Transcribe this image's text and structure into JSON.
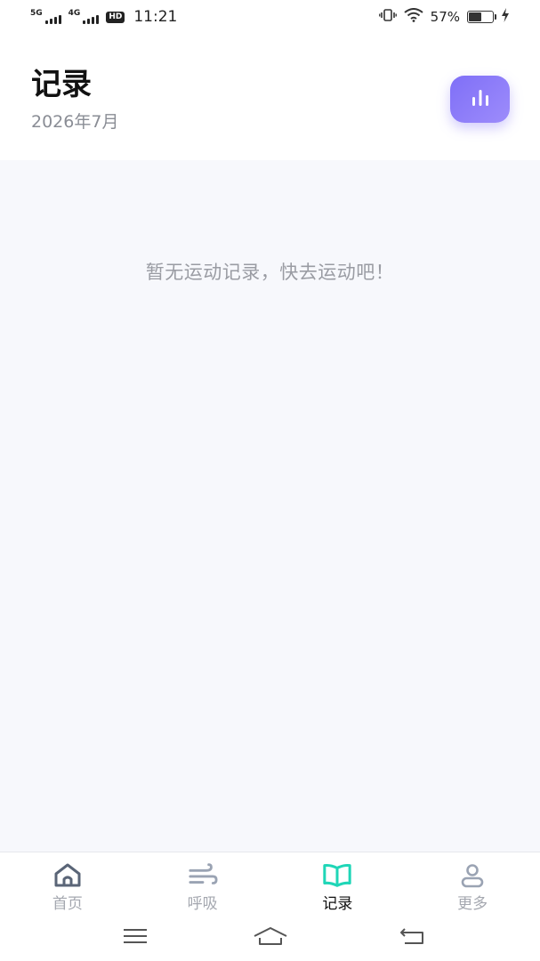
{
  "status_bar": {
    "sig1_label": "5G",
    "sig2_label": "4G",
    "hd_label": "HD",
    "time": "11:21",
    "battery_percent": "57%",
    "battery_level": 0.57
  },
  "header": {
    "title": "记录",
    "subtitle": "2026年7月",
    "stats_icon": "bar-chart-icon"
  },
  "content": {
    "empty_message": "暂无运动记录，快去运动吧！"
  },
  "bottom_nav": {
    "items": [
      {
        "label": "首页",
        "icon": "home-icon",
        "active": false
      },
      {
        "label": "呼吸",
        "icon": "wind-icon",
        "active": false
      },
      {
        "label": "记录",
        "icon": "book-icon",
        "active": true
      },
      {
        "label": "更多",
        "icon": "user-icon",
        "active": false
      }
    ]
  },
  "system_nav": {
    "menu_icon": "menu-icon",
    "home_icon": "home-gesture-icon",
    "back_icon": "back-icon"
  },
  "colors": {
    "accent_purple": "#8a7bf8",
    "accent_teal": "#1fd6b7",
    "background": "#f7f8fc",
    "muted_text": "#9a9ca3"
  }
}
